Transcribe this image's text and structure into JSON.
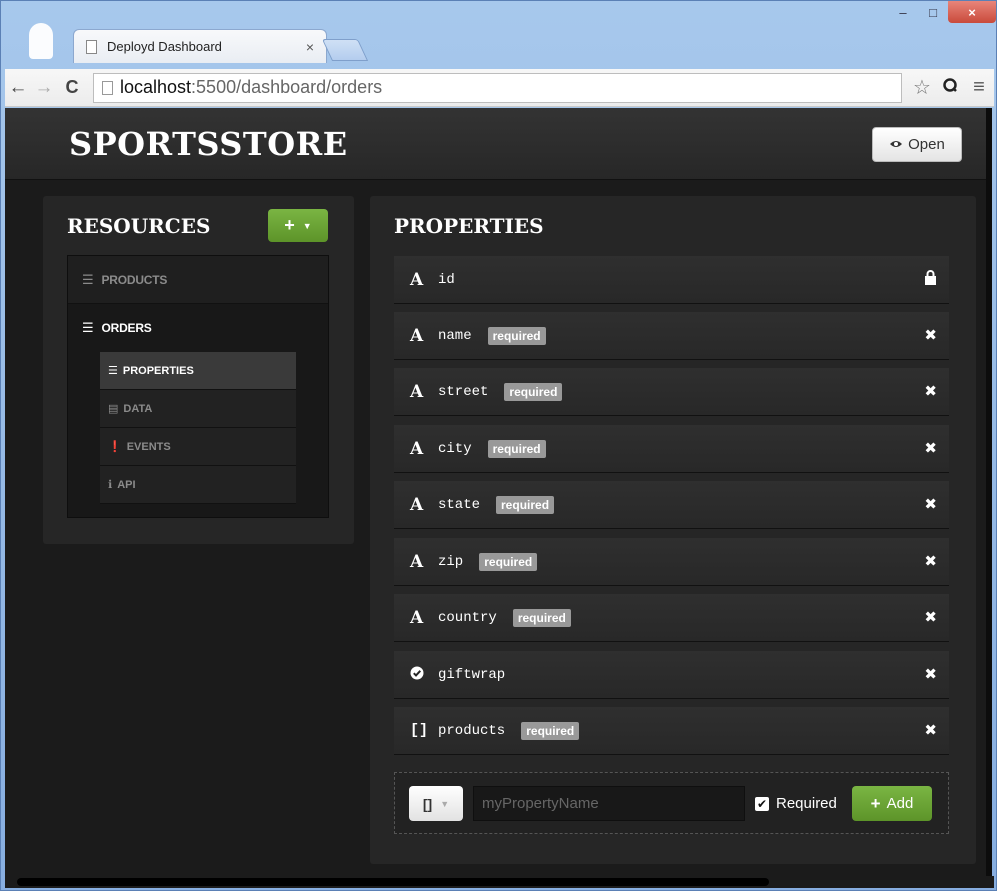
{
  "browser": {
    "tab_title": "Deployd Dashboard",
    "tab_close": "×",
    "url_host": "localhost",
    "url_path": ":5500/dashboard/orders",
    "back": "←",
    "forward": "→",
    "reload": "C",
    "star": "☆",
    "menu": "≡",
    "window_buttons": {
      "minimize": "–",
      "maximize": "□",
      "close": "×"
    }
  },
  "header": {
    "brand": "SPORTSSTORE",
    "open_button": "Open"
  },
  "resources": {
    "title": "RESOURCES",
    "add_button": "+",
    "items": [
      {
        "label": "PRODUCTS",
        "icon": "list-icon"
      },
      {
        "label": "ORDERS",
        "icon": "list-icon"
      }
    ],
    "sub_items": [
      {
        "label": "PROPERTIES",
        "icon": "list-icon",
        "active": true
      },
      {
        "label": "DATA",
        "icon": "table-icon"
      },
      {
        "label": "EVENTS",
        "icon": "exclamation-icon"
      },
      {
        "label": "API",
        "icon": "info-icon"
      }
    ]
  },
  "properties": {
    "title": "PROPERTIES",
    "required_label": "required",
    "rows": [
      {
        "type": "A",
        "name": "id",
        "required": false,
        "action": "lock-icon"
      },
      {
        "type": "A",
        "name": "name",
        "required": true,
        "action": "remove-icon"
      },
      {
        "type": "A",
        "name": "street",
        "required": true,
        "action": "remove-icon"
      },
      {
        "type": "A",
        "name": "city",
        "required": true,
        "action": "remove-icon"
      },
      {
        "type": "A",
        "name": "state",
        "required": true,
        "action": "remove-icon"
      },
      {
        "type": "A",
        "name": "zip",
        "required": true,
        "action": "remove-icon"
      },
      {
        "type": "A",
        "name": "country",
        "required": true,
        "action": "remove-icon"
      },
      {
        "type": "check",
        "name": "giftwrap",
        "required": false,
        "action": "remove-icon"
      },
      {
        "type": "[]",
        "name": "products",
        "required": true,
        "action": "remove-icon"
      }
    ],
    "new_property": {
      "type_value": "[]",
      "placeholder": "myPropertyName",
      "required_label": "Required",
      "required_checked": true,
      "add_button": "Add"
    }
  },
  "colors": {
    "accent_green": "#6aa536",
    "background": "#1b1b1b",
    "badge_gray": "#999999"
  }
}
